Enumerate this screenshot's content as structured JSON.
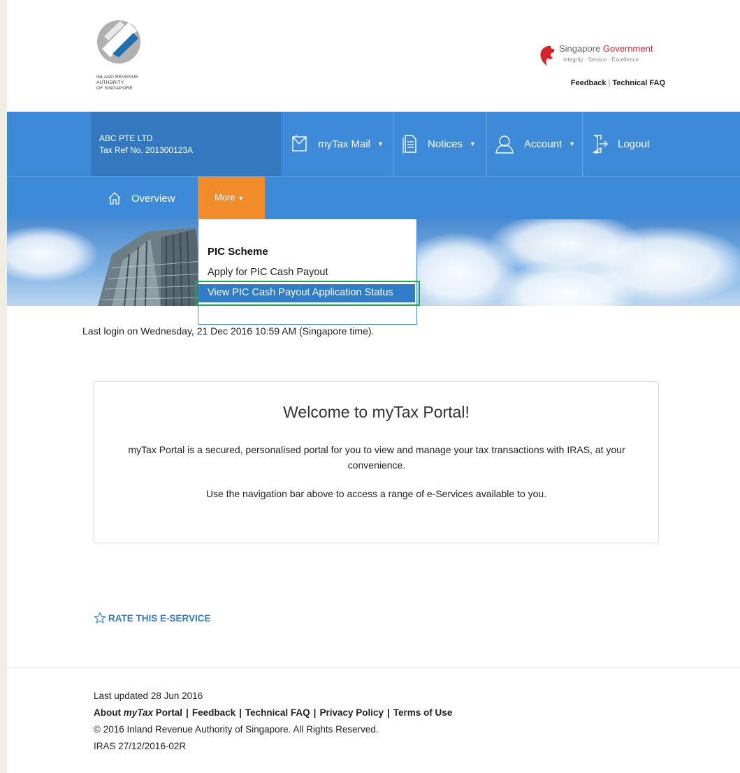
{
  "header": {
    "logo_lines": [
      "INLAND REVENUE",
      "AUTHORITY",
      "OF SINGAPORE"
    ],
    "gov_title_part1": "Singapore",
    "gov_title_part2": "Government",
    "gov_tagline": "Integrity · Service · Excellence",
    "links": [
      "Feedback",
      "Technical FAQ"
    ]
  },
  "account": {
    "company": "ABC PTE LTD",
    "tax_ref": "Tax Ref No. 201300123A"
  },
  "topnav": {
    "mail": "myTax Mail",
    "notices": "Notices",
    "account": "Account",
    "logout": "Logout"
  },
  "subnav": {
    "overview": "Overview",
    "more": "More"
  },
  "dropdown": {
    "section_title": "PIC Scheme",
    "items": [
      "Apply for PIC Cash Payout",
      "View PIC Cash Payout Application Status"
    ]
  },
  "main": {
    "last_login": "Last login on Wednesday, 21 Dec 2016 10:59 AM (Singapore time).",
    "welcome_title": "Welcome to myTax Portal!",
    "welcome_p1": "myTax Portal is a secured, personalised portal for you to view and manage your tax transactions with IRAS, at your convenience.",
    "welcome_p2": "Use the navigation bar above to access a range of e-Services available to you.",
    "rate": "RATE THIS E-SERVICE"
  },
  "footer": {
    "last_updated": "Last updated 28 Jun 2016",
    "about_prefix": "About ",
    "about_italic": "myTax",
    "about_suffix": " Portal",
    "links": [
      "Feedback",
      "Technical FAQ",
      "Privacy Policy",
      "Terms of Use"
    ],
    "copyright": "©  2016  Inland Revenue Authority of Singapore. All Rights Reserved.",
    "version": "IRAS 27/12/2016-02R"
  },
  "colors": {
    "nav_blue": "#3d8bd8",
    "account_blue": "#3479c0",
    "more_orange": "#f28c2b",
    "highlight_blue": "#2f7cc9",
    "frame_green": "#27a54a",
    "gov_red": "#d6222a"
  }
}
